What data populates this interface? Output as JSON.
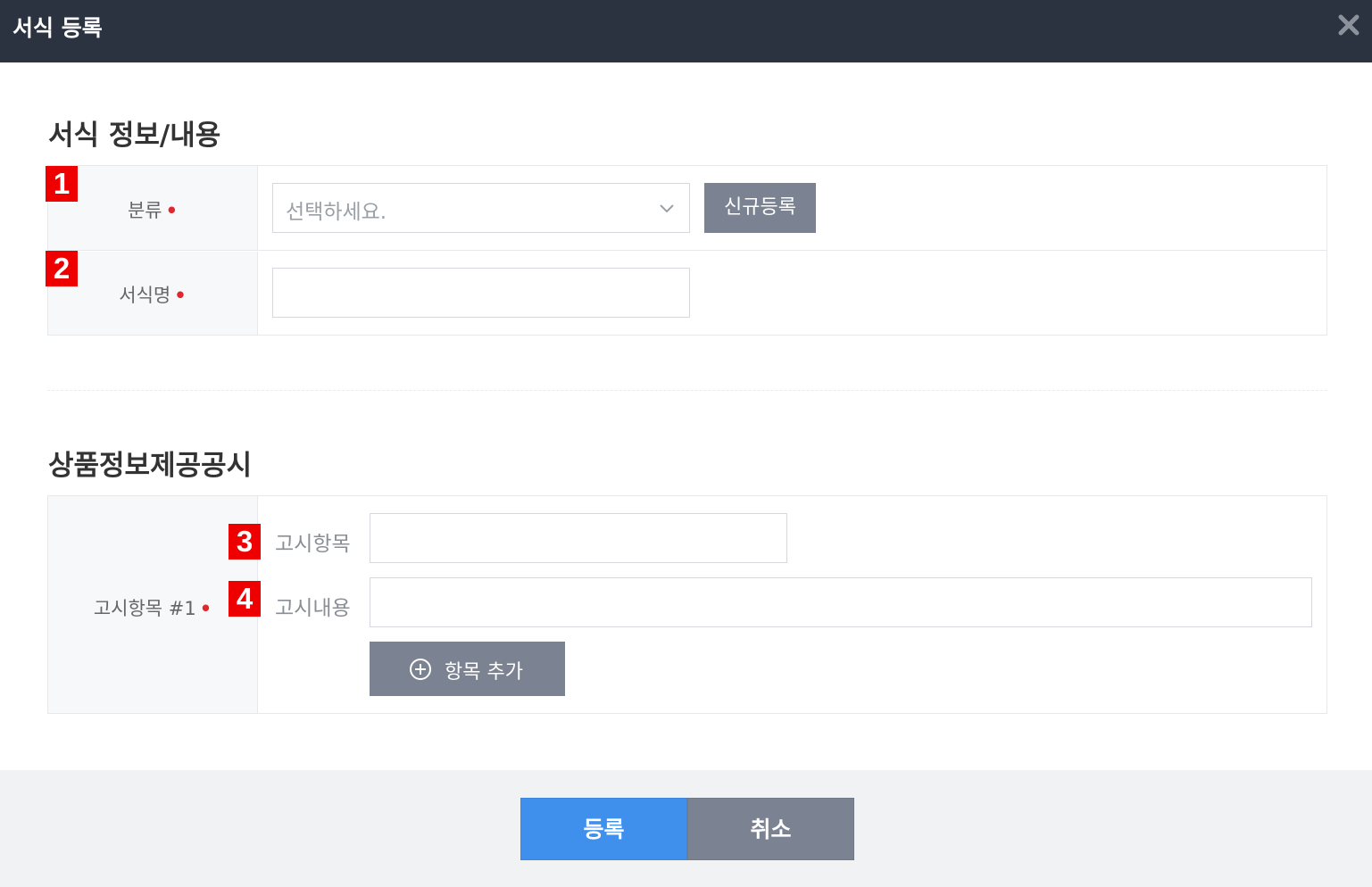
{
  "dialog": {
    "title": "서식 등록",
    "close_icon": "close-icon"
  },
  "form_info": {
    "section_title": "서식 정보/내용",
    "category": {
      "marker": "1",
      "label": "분류",
      "required_mark": "•",
      "select_value": "선택하세요.",
      "new_button": "신규등록"
    },
    "form_name": {
      "marker": "2",
      "label": "서식명",
      "required_mark": "•",
      "value": ""
    }
  },
  "product_notice": {
    "section_title": "상품정보제공공시",
    "row_label": "고시항목 #1",
    "required_mark": "•",
    "item": {
      "marker": "3",
      "label": "고시항목",
      "value": ""
    },
    "content": {
      "marker": "4",
      "label": "고시내용",
      "value": ""
    },
    "add_button": "항목 추가",
    "add_icon": "plus-circle-icon"
  },
  "footer": {
    "submit": "등록",
    "cancel": "취소"
  },
  "colors": {
    "titlebar": "#2b3341",
    "primary": "#3f8fec",
    "secondary_button": "#7b8291",
    "required": "#e0262f",
    "marker": "#ee0000"
  }
}
